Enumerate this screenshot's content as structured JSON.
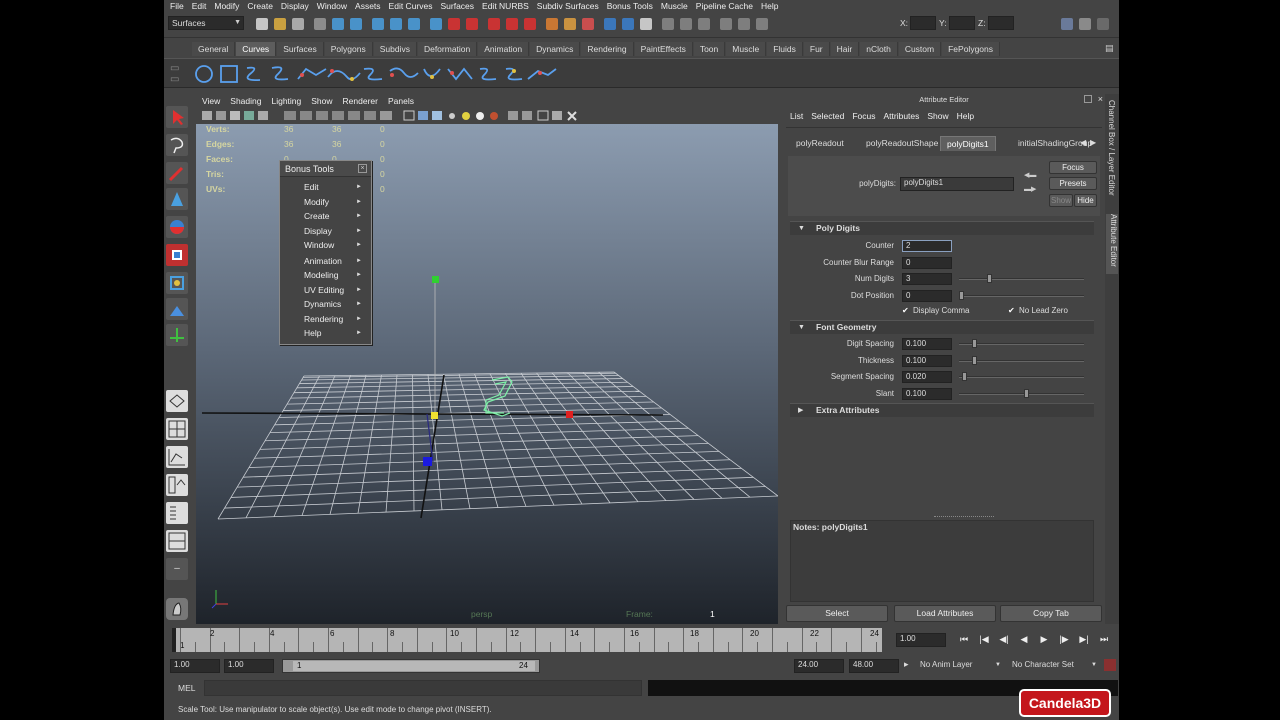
{
  "menubar": [
    "File",
    "Edit",
    "Modify",
    "Create",
    "Display",
    "Window",
    "Assets",
    "Edit Curves",
    "Surfaces",
    "Edit NURBS",
    "Subdiv Surfaces",
    "Bonus Tools",
    "Muscle",
    "Pipeline Cache",
    "Help"
  ],
  "statusline": {
    "mode": "Surfaces",
    "x_label": "X:",
    "y_label": "Y:",
    "z_label": "Z:"
  },
  "shelf_tabs": [
    "General",
    "Curves",
    "Surfaces",
    "Polygons",
    "Subdivs",
    "Deformation",
    "Animation",
    "Dynamics",
    "Rendering",
    "PaintEffects",
    "Toon",
    "Muscle",
    "Fluids",
    "Fur",
    "Hair",
    "nCloth",
    "Custom",
    "FePolygons"
  ],
  "shelf_active": "Curves",
  "viewport": {
    "menu": [
      "View",
      "Shading",
      "Lighting",
      "Show",
      "Renderer",
      "Panels"
    ],
    "hud": [
      {
        "label": "Verts:",
        "v1": "36",
        "v2": "36",
        "v3": "0"
      },
      {
        "label": "Edges:",
        "v1": "36",
        "v2": "36",
        "v3": "0"
      },
      {
        "label": "Faces:",
        "v1": "0",
        "v2": "0",
        "v3": "0"
      },
      {
        "label": "Tris:",
        "v1": "0",
        "v2": "0",
        "v3": "0"
      },
      {
        "label": "UVs:",
        "v1": "0",
        "v2": "0",
        "v3": "0"
      }
    ],
    "camera_label": "persp",
    "frame_label": "Frame:",
    "frame_value": "1"
  },
  "bonus_tools": {
    "title": "Bonus Tools",
    "items": [
      "Edit",
      "Modify",
      "Create",
      "Display",
      "Window",
      "Animation",
      "Modeling",
      "UV Editing",
      "Dynamics",
      "Rendering",
      "Help"
    ]
  },
  "attribute_editor": {
    "title": "Attribute Editor",
    "menu": [
      "List",
      "Selected",
      "Focus",
      "Attributes",
      "Show",
      "Help"
    ],
    "tabs": [
      "polyReadout",
      "polyReadoutShape",
      "polyDigits1",
      "initialShadingGroup"
    ],
    "active_tab": "polyDigits1",
    "node_label": "polyDigits:",
    "node_value": "polyDigits1",
    "buttons": {
      "focus": "Focus",
      "presets": "Presets",
      "show": "Show",
      "hide": "Hide"
    },
    "sections": {
      "poly_digits": "Poly Digits",
      "font_geometry": "Font Geometry",
      "extra": "Extra Attributes"
    },
    "poly_digits_attrs": [
      {
        "label": "Counter",
        "value": "2",
        "slider": null
      },
      {
        "label": "Counter Blur Range",
        "value": "0",
        "slider": null
      },
      {
        "label": "Num Digits",
        "value": "3",
        "slider": 0.22
      },
      {
        "label": "Dot Position",
        "value": "0",
        "slider": 0.0
      }
    ],
    "checkboxes": [
      {
        "label": "Display Comma",
        "checked": true
      },
      {
        "label": "No Lead Zero",
        "checked": true
      }
    ],
    "font_attrs": [
      {
        "label": "Digit Spacing",
        "value": "0.100",
        "slider": 0.1
      },
      {
        "label": "Thickness",
        "value": "0.100",
        "slider": 0.1
      },
      {
        "label": "Segment Spacing",
        "value": "0.020",
        "slider": 0.02
      },
      {
        "label": "Slant",
        "value": "0.100",
        "slider": 0.52
      }
    ],
    "notes_label": "Notes:  polyDigits1",
    "bottom_buttons": [
      "Select",
      "Load Attributes",
      "Copy Tab"
    ],
    "side_tabs": "Channel Box / Layer Editor",
    "side_tabs2": "Attribute Editor"
  },
  "timeslider": {
    "ticks": [
      "2",
      "4",
      "6",
      "8",
      "10",
      "12",
      "14",
      "16",
      "18",
      "20",
      "22",
      "24"
    ],
    "start_marker": "1",
    "current_frame": "1.00"
  },
  "rangeslider": {
    "start": "1.00",
    "inner_start": "1.00",
    "range_start": "1",
    "range_end": "24",
    "end": "24.00",
    "outer_end": "48.00",
    "anim_layer": "No Anim Layer",
    "character_set": "No Character Set"
  },
  "cmdline": {
    "label": "MEL"
  },
  "helpline": "Scale Tool: Use manipulator to scale object(s). Use edit mode to change pivot (INSERT).",
  "logo": "Candela3D"
}
